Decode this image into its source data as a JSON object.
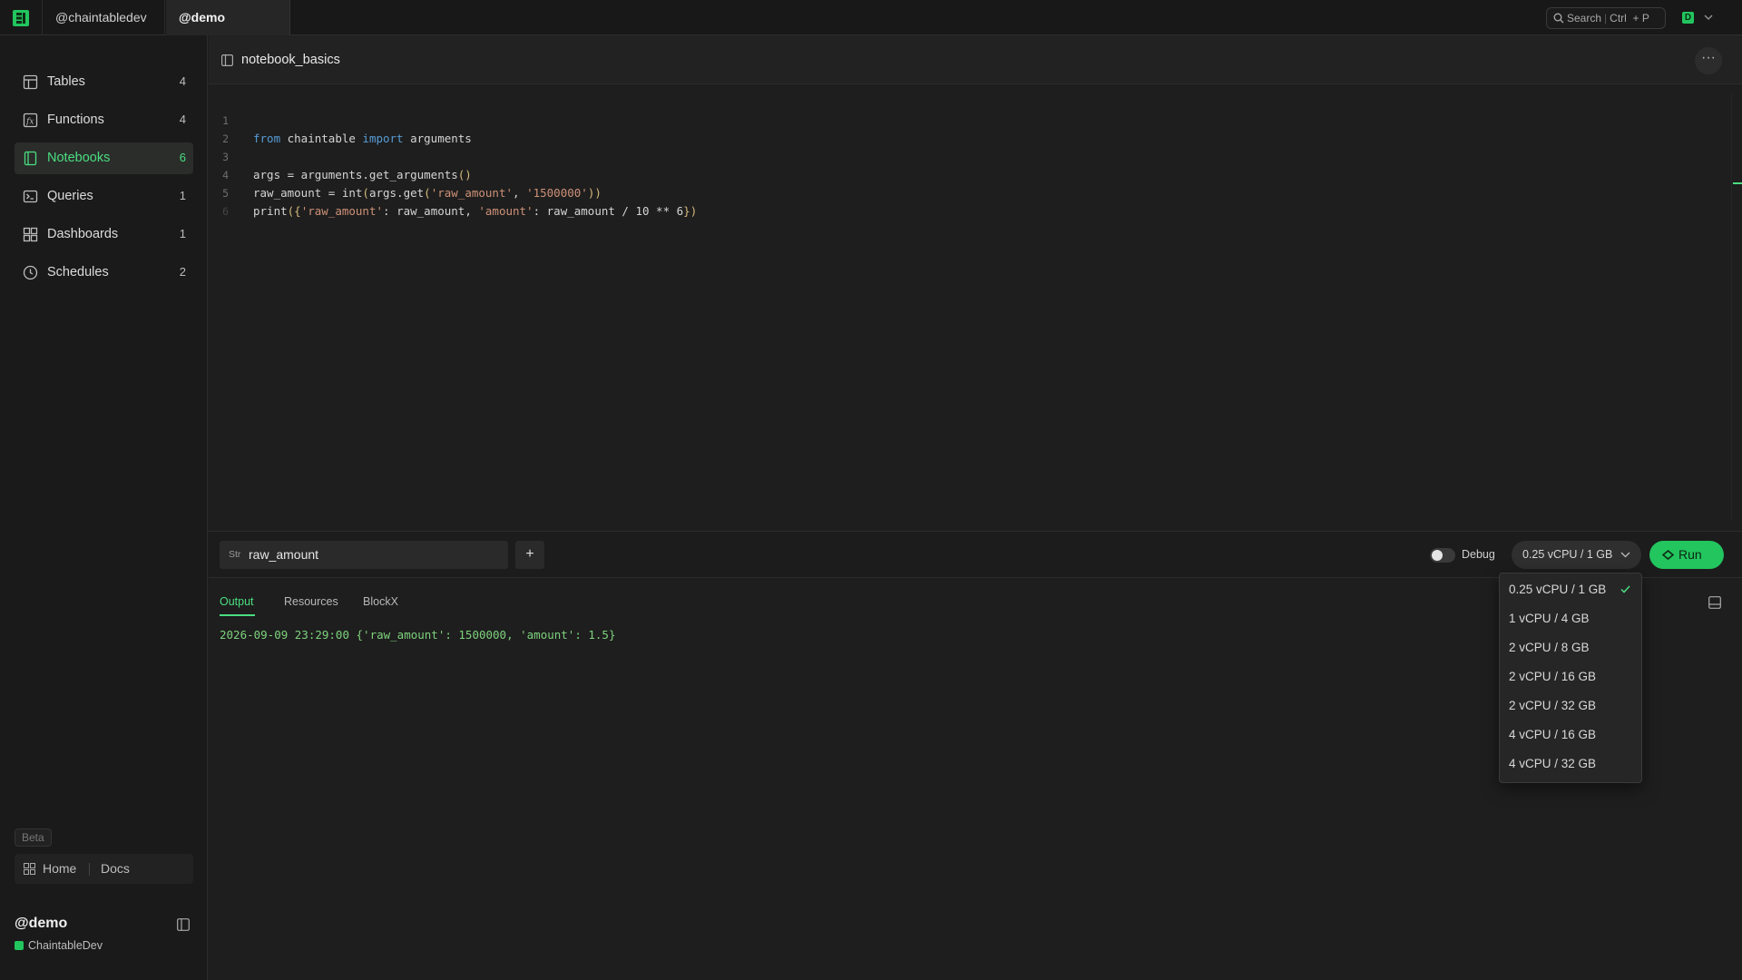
{
  "topbar": {
    "workspace_tabs": [
      "@chaintabledev",
      "@demo"
    ],
    "search": {
      "label": "Search",
      "shortcut_a": "Ctrl",
      "shortcut_b": "+ P"
    },
    "user_initial": "D"
  },
  "sidebar": {
    "items": [
      {
        "label": "Tables",
        "count": "4",
        "icon": "table-icon"
      },
      {
        "label": "Functions",
        "count": "4",
        "icon": "function-icon"
      },
      {
        "label": "Notebooks",
        "count": "6",
        "icon": "notebook-icon",
        "active": true
      },
      {
        "label": "Queries",
        "count": "1",
        "icon": "terminal-icon"
      },
      {
        "label": "Dashboards",
        "count": "1",
        "icon": "dashboard-icon"
      },
      {
        "label": "Schedules",
        "count": "2",
        "icon": "clock-icon"
      }
    ],
    "beta_label": "Beta",
    "home_label": "Home",
    "docs_label": "Docs",
    "account_name": "@demo",
    "org_name": "ChaintableDev"
  },
  "editor": {
    "notebook_title": "notebook_basics",
    "more_label": "···",
    "line_numbers": [
      "1",
      "2",
      "3",
      "4",
      "5",
      "6"
    ]
  },
  "args": {
    "type_label": "Str",
    "name": "raw_amount",
    "add_label": "+"
  },
  "controls": {
    "debug_label": "Debug",
    "debug_on": false,
    "selected_compute": "0.25 vCPU / 1 GB",
    "run_label": "Run"
  },
  "output": {
    "tabs": [
      "Output",
      "Resources",
      "BlockX"
    ],
    "active_tab": "Output",
    "log_line": "2026-09-09 23:29:00 {'raw_amount': 1500000, 'amount': 1.5}"
  },
  "compute_options": [
    "0.25 vCPU / 1 GB",
    "1 vCPU / 4 GB",
    "2 vCPU / 8 GB",
    "2 vCPU / 16 GB",
    "2 vCPU / 32 GB",
    "4 vCPU / 16 GB",
    "4 vCPU / 32 GB"
  ],
  "colors": {
    "accent": "#4ade80",
    "run_button": "#22c55e",
    "background": "#1e1e1e",
    "sidebar": "#1a1a1a",
    "keyword": "#569cd6",
    "string": "#ce9178"
  }
}
